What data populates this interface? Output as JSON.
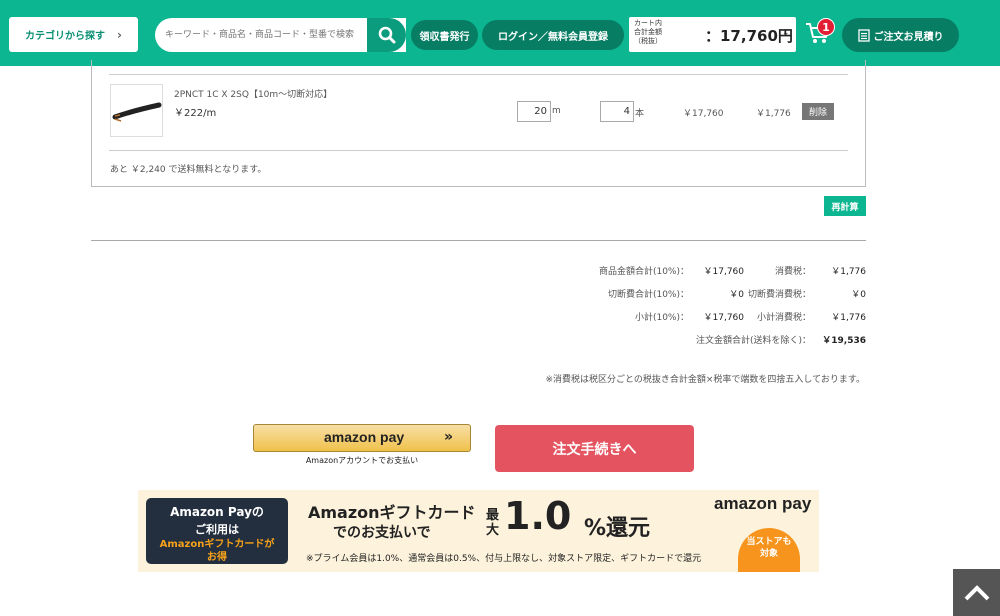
{
  "header": {
    "category_button": "カテゴリから探す",
    "search_placeholder": "キーワード・商品名・商品コード・型番で検索",
    "receipt_button": "領収書発行",
    "login_button": "ログイン／無料会員登録",
    "cart_label": "カート内\n合計金額\n（税抜）",
    "cart_amount": "：17,760円",
    "cart_badge": "1",
    "quote_button": "ご注文お見積り"
  },
  "cart": {
    "item": {
      "name": "2PNCT 1C X 2SQ【10m～切断対応】",
      "unit_price": "￥222/m",
      "length": "20",
      "length_unit": "m",
      "count": "4",
      "count_unit": "本",
      "subtotal": "￥17,760",
      "tax": "￥1,776",
      "delete_label": "削除"
    },
    "free_shipping_note": "あと ￥2,240 で送料無料となります。",
    "recalc_label": "再計算"
  },
  "summary": {
    "rows": [
      {
        "label": "商品金額合計(10%)：",
        "value": "￥17,760",
        "tax_label": "消費税：",
        "tax_value": "￥1,776"
      },
      {
        "label": "切断費合計(10%)：",
        "value": "￥0",
        "tax_label": "切断費消費税：",
        "tax_value": "￥0"
      },
      {
        "label": "小計(10%)：",
        "value": "￥17,760",
        "tax_label": "小計消費税：",
        "tax_value": "￥1,776"
      }
    ],
    "total_label": "注文金額合計(送料を除く)：",
    "total_value": "￥19,536",
    "tax_note": "※消費税は税区分ごとの税抜き合計金額×税率で端数を四捨五入しております。"
  },
  "actions": {
    "amazon_pay_logo": "amazon pay",
    "amazon_pay_sub": "Amazonアカウントでお支払い",
    "order_button": "注文手続きへ"
  },
  "banner": {
    "dark_line1": "Amazon Payの",
    "dark_line2": "ご利用は",
    "dark_line3": "Amazonギフトカードが",
    "dark_line4": "お得",
    "title1": "Amazonギフトカード",
    "title2": "でのお支払いで",
    "max": "最大",
    "rate": "1.0",
    "pct": "%還元",
    "fine_print": "※プライム会員は1.0%、通常会員は0.5%、付与上限なし、対象ストア限定、ギフトカードで還元",
    "logo": "amazon pay",
    "store_badge_1": "当ストアも",
    "store_badge_2": "対象"
  },
  "colors": {
    "brand": "#0bb691",
    "order": "#e45460"
  }
}
